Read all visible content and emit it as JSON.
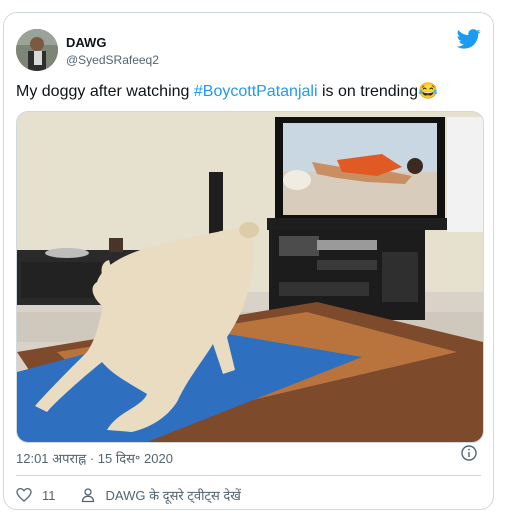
{
  "tweet": {
    "author_name": "DAWG",
    "author_handle": "@SyedSRafeeq2",
    "text_before": "My doggy after watching ",
    "hashtag": "#BoycottPatanjali",
    "text_after": " is on trending",
    "emoji": "😂",
    "timestamp": "12:01 अपराह्न · 15 दिस॰ 2020",
    "like_count": "11",
    "more_tweets_label": "DAWG के दूसरे ट्वीट्स देखें"
  },
  "icons": {
    "brand": "twitter-bird-icon",
    "info": "info-icon",
    "like": "heart-icon",
    "profile": "person-icon"
  },
  "colors": {
    "accent": "#1d9bf0",
    "text": "#0f1419",
    "secondary": "#536471",
    "border": "#cfd9de"
  }
}
